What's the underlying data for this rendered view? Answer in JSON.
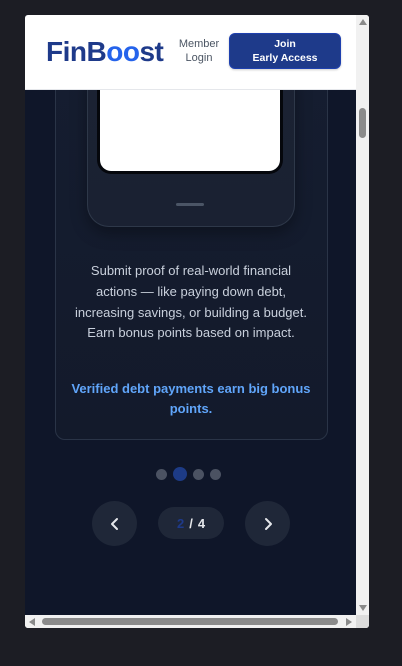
{
  "header": {
    "logo_text_a": "FinB",
    "logo_text_o": "oo",
    "logo_text_b": "st",
    "member_login_line1": "Member",
    "member_login_line2": "Login",
    "join_line1": "Join",
    "join_line2": "Early Access"
  },
  "card": {
    "description": "Submit proof of real-world financial actions — like paying down debt, increasing savings, or building a budget. Earn bonus points based on impact.",
    "highlight": "Verified debt payments earn big bonus points."
  },
  "carousel": {
    "current": "2",
    "separator": "/",
    "total": "4",
    "active_index": 1,
    "dot_count": 4
  },
  "colors": {
    "brand_dark": "#1e3a8a",
    "accent_blue": "#60a5fa",
    "page_bg": "#0f1629"
  },
  "icons": {
    "prev": "chevron-left-icon",
    "next": "chevron-right-icon"
  }
}
